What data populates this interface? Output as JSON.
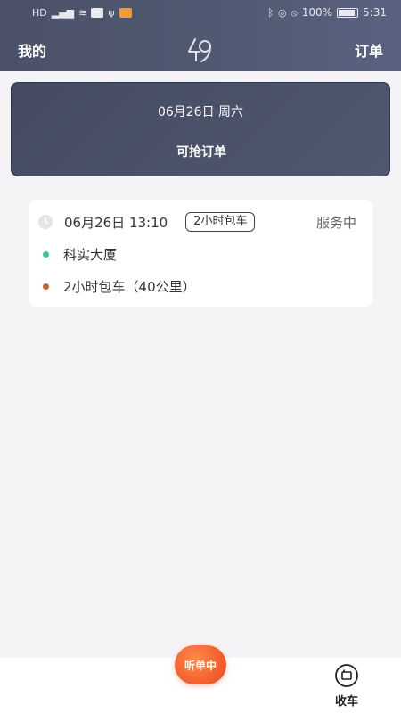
{
  "status_bar": {
    "left_icons": [
      "sim-hd-icon",
      "signal-icon",
      "wifi-icon",
      "app-notify-icon",
      "usb-icon",
      "media-icon"
    ],
    "battery": "100%",
    "time": "5:31"
  },
  "header": {
    "left_link": "我的",
    "right_link": "订单",
    "logo": "brand-49-logo"
  },
  "date_card": {
    "date": "06月26日 周六",
    "action": "可抢订单"
  },
  "order": {
    "time": "06月26日 13:10",
    "type_badge": "2小时包车",
    "status": "服务中",
    "location": "科实大厦",
    "detail": "2小时包车（40公里）"
  },
  "bottom_bar": {
    "listen_label": "听单中",
    "park_label": "收车"
  },
  "colors": {
    "header": "#4e566e",
    "accent_orange": "#f25a2a",
    "dot_green": "#3ac39d",
    "dot_brown": "#c0642e"
  }
}
